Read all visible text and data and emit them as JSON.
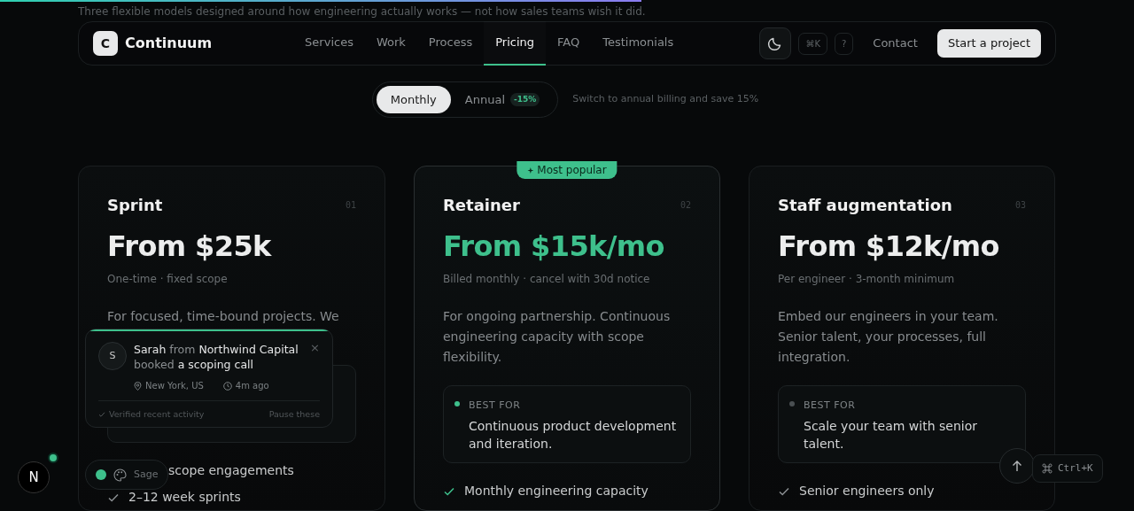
{
  "scroll_progress": {
    "level": 0.566
  },
  "intro_text": "Three flexible models designed around how engineering actually works — not how sales teams wish it did.",
  "nav": {
    "logo_letter": "C",
    "brand": "Continuum",
    "links": [
      {
        "label": "Services",
        "selected": false
      },
      {
        "label": "Work",
        "selected": false
      },
      {
        "label": "Process",
        "selected": false
      },
      {
        "label": "Pricing",
        "selected": true
      },
      {
        "label": "FAQ",
        "selected": false
      },
      {
        "label": "Testimonials",
        "selected": false
      }
    ],
    "shortcut_key": "⌘K",
    "help_key": "?",
    "contact": "Contact",
    "cta": "Start a project"
  },
  "billing": {
    "options": [
      {
        "label": "Monthly",
        "selected": true
      },
      {
        "label": "Annual",
        "selected": false,
        "badge": "-15%"
      }
    ],
    "hint": "Switch to annual billing and save 15%"
  },
  "plans": [
    {
      "title": "Sprint",
      "number": "01",
      "featured": false,
      "price": "From $25k",
      "terms": "One-time · fixed scope",
      "description": "For focused, time-bound projects. We",
      "features": [
        {
          "text": "scope engagements",
          "icon": false
        },
        {
          "text": "2–12 week sprints",
          "icon": true
        }
      ]
    },
    {
      "title": "Retainer",
      "number": "02",
      "featured": true,
      "badge": "Most popular",
      "price": "From $15k/mo",
      "terms": "Billed monthly · cancel with 30d notice",
      "description": "For ongoing partnership. Continuous engineering capacity with scope flexibility.",
      "best_for": {
        "label": "BEST FOR",
        "text": "Continuous product development and iteration.",
        "color": "#3ec08c"
      },
      "features": [
        {
          "text": "Monthly engineering capacity",
          "icon": true
        }
      ]
    },
    {
      "title": "Staff augmentation",
      "number": "03",
      "featured": false,
      "price": "From $12k/mo",
      "terms": "Per engineer · 3-month minimum",
      "description": "Embed our engineers in your team. Senior talent, your processes, full integration.",
      "best_for": {
        "label": "BEST FOR",
        "text": "Scale your team with senior talent.",
        "color": "#4a4f52"
      },
      "features": [
        {
          "text": "Senior engineers only",
          "icon": true
        }
      ]
    }
  ],
  "toast": {
    "avatar": "S",
    "message": "**Sarah** from **Northwind Capital** booked **a scoping call**",
    "location": "New York, US",
    "time": "4m ago",
    "verified": "Verified recent activity",
    "pause": "Pause these",
    "close": "×"
  },
  "theme_pill": {
    "label": "Sage",
    "color": "#3ec08c"
  },
  "dev_badge": {
    "letter": "N"
  },
  "shortcut_pill": {
    "label": "Ctrl+K"
  }
}
